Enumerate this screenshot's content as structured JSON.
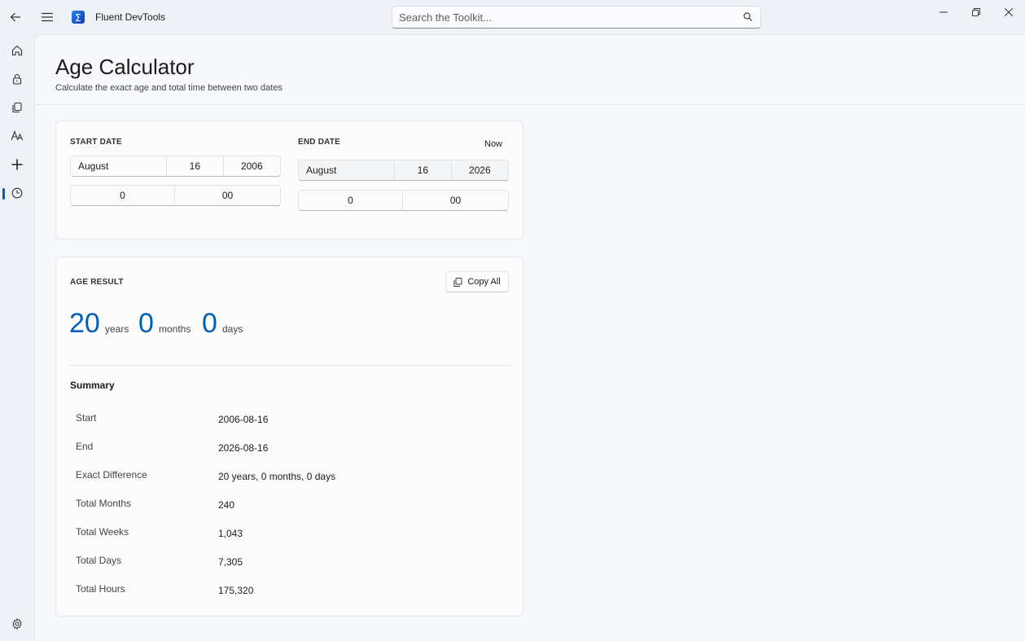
{
  "app": {
    "title": "Fluent DevTools",
    "icon_glyph": "∑"
  },
  "search": {
    "placeholder": "Search the Toolkit..."
  },
  "sidebar": {
    "items": [
      {
        "icon": "home-icon"
      },
      {
        "icon": "lock-icon"
      },
      {
        "icon": "copy-icon"
      },
      {
        "icon": "text-icon"
      },
      {
        "icon": "plus-icon"
      },
      {
        "icon": "clock-icon",
        "selected": true
      }
    ],
    "footer_icon": "settings-icon"
  },
  "page": {
    "title": "Age Calculator",
    "subtitle": "Calculate the exact age and total time between two dates"
  },
  "start_date": {
    "label": "START DATE",
    "month": "August",
    "day": "16",
    "year": "2006",
    "hour": "0",
    "minute": "00"
  },
  "end_date": {
    "label": "END DATE",
    "now_label": "Now",
    "month": "August",
    "day": "16",
    "year": "2026",
    "hour": "0",
    "minute": "00"
  },
  "result": {
    "label": "AGE RESULT",
    "copy_all_label": "Copy All",
    "years": "20",
    "years_unit": "years",
    "months": "0",
    "months_unit": "months",
    "days": "0",
    "days_unit": "days"
  },
  "summary": {
    "title": "Summary",
    "rows": [
      {
        "label": "Start",
        "value": "2006-08-16"
      },
      {
        "label": "End",
        "value": "2026-08-16"
      },
      {
        "label": "Exact Difference",
        "value": "20 years, 0 months, 0 days"
      },
      {
        "label": "Total Months",
        "value": "240"
      },
      {
        "label": "Total Weeks",
        "value": "1,043"
      },
      {
        "label": "Total Days",
        "value": "7,305"
      },
      {
        "label": "Total Hours",
        "value": "175,320"
      }
    ]
  },
  "colors": {
    "accent": "#005fb8",
    "window_bg": "#eef1f6",
    "content_bg": "#f7f8fb"
  }
}
